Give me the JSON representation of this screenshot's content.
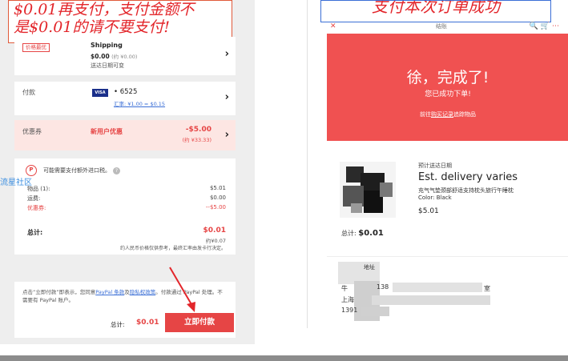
{
  "left": {
    "annotation": [
      "$0.01再支付，支付金额不",
      "是$0.01的请不要支付!"
    ],
    "shipping": {
      "tag": "价格最优",
      "title": "Shipping",
      "price": "$0.00",
      "price_cny": "(约 ¥0.00)",
      "eta": "送达日期可变"
    },
    "payment": {
      "label": "付款",
      "card_brand": "VISA",
      "card_number": "• 6525",
      "rate": "汇率: ¥1.00 = $0.15"
    },
    "coupon": {
      "label": "优惠券",
      "name": "新用户优惠",
      "amount": "-$5.00",
      "amount_cny": "(约 ¥33.33)"
    },
    "summary": {
      "tax_note": "可能需要支付额外进口税。",
      "items_label": "物品 (1):",
      "items_value": "$5.01",
      "shipping_label": "运费:",
      "shipping_value": "$0.00",
      "coupon_label": "优惠券:",
      "coupon_value": "--$5.00",
      "total_label": "总计:",
      "total_value": "$0.01",
      "total_cny": "约¥0.07",
      "note": "约人民币价格仅供参考，最终汇率由发卡行决定。"
    },
    "footer": {
      "agree_prefix": "点击“立即付款”即表示，您同意",
      "link1": "PayPal 条款",
      "and": "及",
      "link2": "隐私权政策",
      "agree_suffix": "。付款通过 PayPal 处理。不需要有 PayPal 账户。",
      "total_label": "总计:",
      "total_value": "$0.01",
      "pay_button": "立即付款"
    },
    "watermark": "流星社区"
  },
  "right": {
    "annotation": "支付本次订单成功",
    "nav": {
      "back": "✕",
      "title": "结账",
      "icons": "🔍 🛒 ⋯"
    },
    "banner": {
      "title": "徐，完成了!",
      "subtitle": "您已成功下单!",
      "link_prefix": "前往",
      "link": "购买记录",
      "link_suffix": "追踪物品"
    },
    "order": {
      "eta_label": "预计送达日期",
      "eta": "Est. delivery varies",
      "product_name": "充气气垫颈部舒适支持枕头旅行午睡枕",
      "color": "Color: Black",
      "price": "$5.01",
      "total_label": "总计:",
      "total_value": "$0.01"
    },
    "address": {
      "label": "地址",
      "line1": "牛",
      "line1_b": "138",
      "line1_c": "室",
      "line2": "上海",
      "line3": "1391"
    }
  }
}
